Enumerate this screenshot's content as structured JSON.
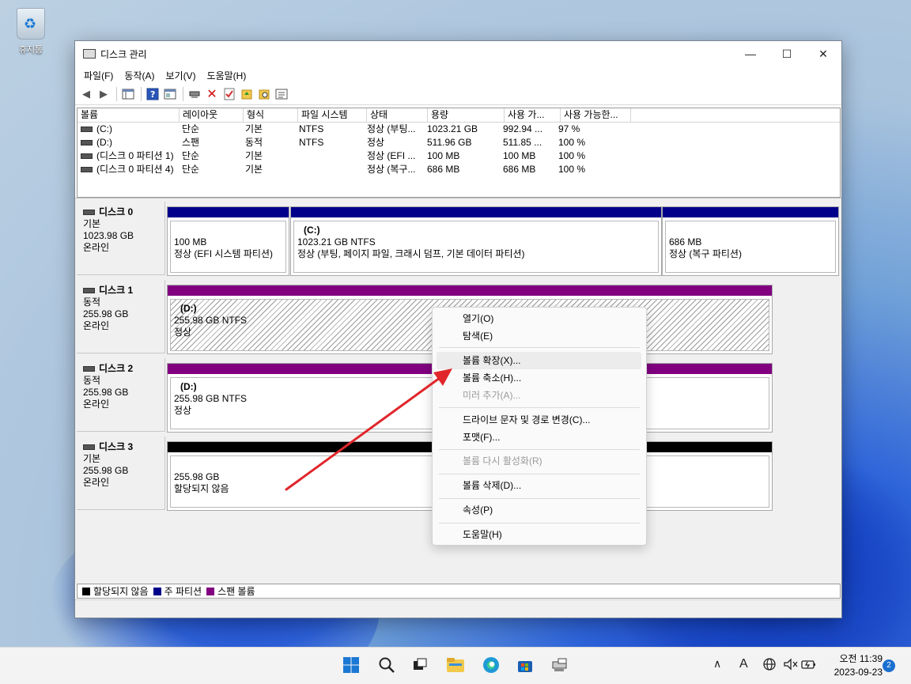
{
  "desktop": {
    "recycle_bin_label": "휴지통"
  },
  "window": {
    "title": "디스크 관리",
    "controls": [
      "—",
      "☐",
      "✕"
    ]
  },
  "menu": [
    "파일(F)",
    "동작(A)",
    "보기(V)",
    "도움말(H)"
  ],
  "volume_list": {
    "columns": [
      "볼륨",
      "레이아웃",
      "형식",
      "파일 시스템",
      "상태",
      "용량",
      "사용 가...",
      "사용 가능한..."
    ],
    "rows": [
      [
        "(C:)",
        "단순",
        "기본",
        "NTFS",
        "정상 (부팅...",
        "1023.21 GB",
        "992.94 ...",
        "97 %"
      ],
      [
        "(D:)",
        "스팬",
        "동적",
        "NTFS",
        "정상",
        "511.96 GB",
        "511.85 ...",
        "100 %"
      ],
      [
        "(디스크 0 파티션 1)",
        "단순",
        "기본",
        "",
        "정상 (EFI ...",
        "100 MB",
        "100 MB",
        "100 %"
      ],
      [
        "(디스크 0 파티션 4)",
        "단순",
        "기본",
        "",
        "정상 (복구...",
        "686 MB",
        "686 MB",
        "100 %"
      ]
    ]
  },
  "disks": [
    {
      "name": "디스크 0",
      "type": "기본",
      "size": "1023.98 GB",
      "status": "온라인",
      "partitions": [
        {
          "name": "",
          "line1": "100 MB",
          "line2": "정상 (EFI 시스템 파티션)"
        },
        {
          "name": "(C:)",
          "line1": "1023.21 GB NTFS",
          "line2": "정상 (부팅, 페이지 파일, 크래시 덤프, 기본 데이터 파티션)"
        },
        {
          "name": "",
          "line1": "686 MB",
          "line2": "정상 (복구 파티션)"
        }
      ]
    },
    {
      "name": "디스크 1",
      "type": "동적",
      "size": "255.98 GB",
      "status": "온라인",
      "partitions": [
        {
          "name": "(D:)",
          "line1": "255.98 GB NTFS",
          "line2": "정상"
        }
      ]
    },
    {
      "name": "디스크 2",
      "type": "동적",
      "size": "255.98 GB",
      "status": "온라인",
      "partitions": [
        {
          "name": "(D:)",
          "line1": "255.98 GB NTFS",
          "line2": "정상"
        }
      ]
    },
    {
      "name": "디스크 3",
      "type": "기본",
      "size": "255.98 GB",
      "status": "온라인",
      "partitions": [
        {
          "name": "",
          "line1": "255.98 GB",
          "line2": "할당되지 않음"
        }
      ]
    }
  ],
  "legend": [
    {
      "label": "할당되지 않음",
      "color": "#000000"
    },
    {
      "label": "주 파티션",
      "color": "#00008b"
    },
    {
      "label": "스팬 볼륨",
      "color": "#800080"
    }
  ],
  "context_menu": {
    "items": [
      {
        "label": "열기(O)",
        "disabled": false
      },
      {
        "label": "탐색(E)",
        "disabled": false
      },
      {
        "label": "볼륨 확장(X)...",
        "disabled": false,
        "hover": true
      },
      {
        "label": "볼륨 축소(H)...",
        "disabled": false
      },
      {
        "label": "미러 추가(A)...",
        "disabled": true
      },
      {
        "label": "드라이브 문자 및 경로 변경(C)...",
        "disabled": false
      },
      {
        "label": "포맷(F)...",
        "disabled": false
      },
      {
        "label": "볼륨 다시 활성화(R)",
        "disabled": true
      },
      {
        "label": "볼륨 삭제(D)...",
        "disabled": false
      },
      {
        "label": "속성(P)",
        "disabled": false
      },
      {
        "label": "도움말(H)",
        "disabled": false
      }
    ]
  },
  "annotation": {
    "arrow_color": "#e0262b"
  },
  "taskbar": {
    "clock_time": "오전 11:39",
    "clock_date": "2023-09-23",
    "notification_count": "2",
    "tray_ime": "A"
  }
}
